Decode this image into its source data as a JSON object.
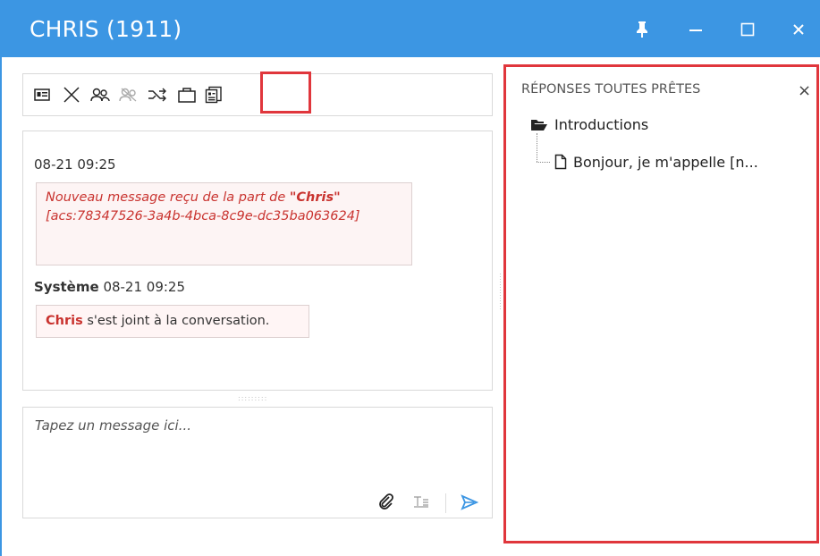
{
  "window": {
    "title": "CHRIS (1911)",
    "controls": [
      "pin-icon",
      "minimize-icon",
      "maximize-icon",
      "close-icon"
    ]
  },
  "toolbar": {
    "icons": [
      "contact-card-icon",
      "end-chat-icon",
      "conference-icon",
      "conference-disabled-icon",
      "transfer-icon",
      "briefcase-icon",
      "ready-responses-icon"
    ],
    "highlighted": "ready-responses-icon"
  },
  "conversation": {
    "entries": [
      {
        "timestamp": "08-21 09:25",
        "message_prefix": "Nouveau message reçu de la part de ",
        "message_name": "\"Chris\"",
        "message_id": "[acs:78347526-3a4b-4bca-8c9e-dc35ba063624]"
      },
      {
        "sender": "Système",
        "timestamp": "08-21 09:25",
        "name": "Chris",
        "text": " s'est joint à la conversation."
      }
    ]
  },
  "compose": {
    "placeholder": "Tapez un message ici...",
    "actions": [
      "attach-icon",
      "text-format-icon",
      "send-icon"
    ]
  },
  "ready_responses": {
    "title": "RÉPONSES TOUTES PRÊTES",
    "close": "×",
    "tree": {
      "folder": "Introductions",
      "items": [
        "Bonjour, je m'appelle [n..."
      ]
    }
  },
  "colors": {
    "titlebar": "#3c96e3",
    "highlight": "#e0363c",
    "message_text": "#c9332f",
    "send_icon": "#3c96e3"
  }
}
